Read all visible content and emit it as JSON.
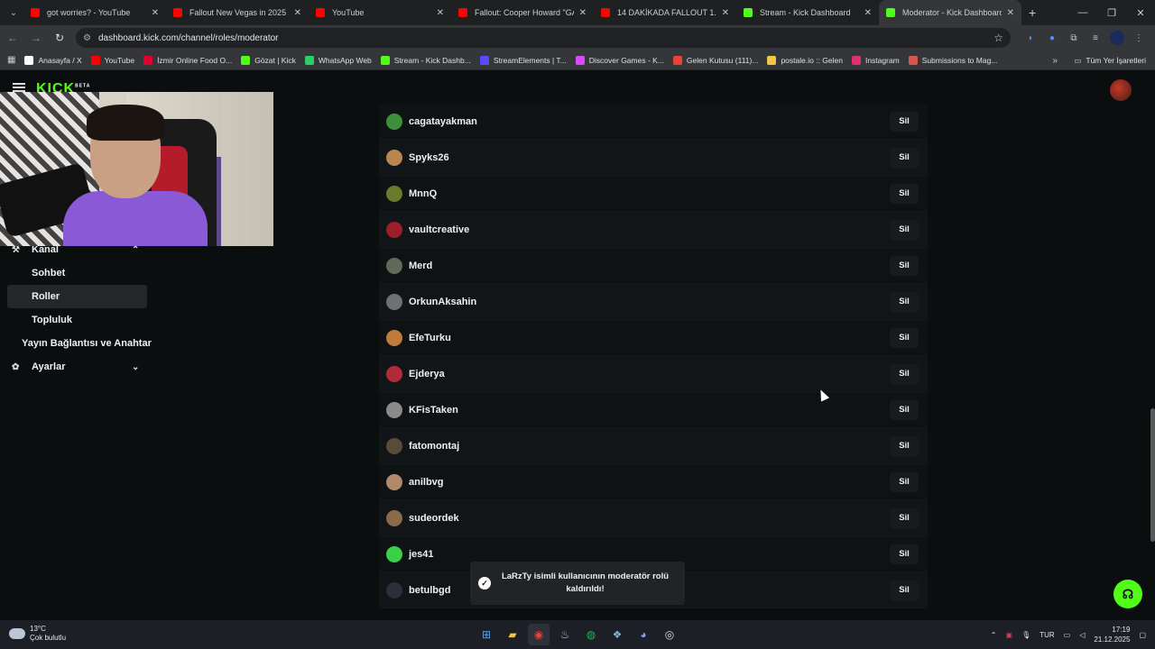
{
  "browser": {
    "tabs": [
      {
        "title": "got worries? - YouTube",
        "color": "#ff0000",
        "active": false
      },
      {
        "title": "Fallout New Vegas in 2025 is A",
        "color": "#ff0000",
        "active": false
      },
      {
        "title": "YouTube",
        "color": "#ff0000",
        "active": false
      },
      {
        "title": "Fallout: Cooper Howard \"GALA",
        "color": "#ff0000",
        "active": false
      },
      {
        "title": "14 DAKİKADA FALLOUT 1. SEZO",
        "color": "#ff0000",
        "active": false
      },
      {
        "title": "Stream - Kick Dashboard",
        "color": "#53fc18",
        "active": false
      },
      {
        "title": "Moderator - Kick Dashboard",
        "color": "#53fc18",
        "active": true
      }
    ],
    "url": "dashboard.kick.com/channel/roles/moderator",
    "bookmarks": [
      {
        "label": "Anasayfa / X",
        "color": "#ffffff"
      },
      {
        "label": "YouTube",
        "color": "#ff0000"
      },
      {
        "label": "İzmir Online Food O...",
        "color": "#e4002b"
      },
      {
        "label": "Gözat | Kick",
        "color": "#53fc18"
      },
      {
        "label": "WhatsApp Web",
        "color": "#25d366"
      },
      {
        "label": "Stream - Kick Dashb...",
        "color": "#53fc18"
      },
      {
        "label": "StreamElements | T...",
        "color": "#5b4bff"
      },
      {
        "label": "Discover Games - K...",
        "color": "#d94aff"
      },
      {
        "label": "Gelen Kutusu (111)...",
        "color": "#ea4335"
      },
      {
        "label": "postale.io :: Gelen",
        "color": "#f4c542"
      },
      {
        "label": "Instagram",
        "color": "#e1306c"
      },
      {
        "label": "Submissions to Mag...",
        "color": "#d9534f"
      }
    ],
    "all_bookmarks": "Tüm Yer İşaretleri"
  },
  "app": {
    "logo": "KICK",
    "logo_badge": "BETA"
  },
  "sidebar": {
    "items": [
      {
        "label": "Kanal",
        "type": "section",
        "icon": "channel-icon",
        "chevron": "⌃"
      },
      {
        "label": "Sohbet",
        "type": "sub"
      },
      {
        "label": "Roller",
        "type": "sub",
        "active": true
      },
      {
        "label": "Topluluk",
        "type": "sub"
      },
      {
        "label": "Yayın Bağlantısı ve Anahtar",
        "type": "plain"
      },
      {
        "label": "Ayarlar",
        "type": "section",
        "icon": "gear-icon",
        "chevron": "⌄"
      }
    ]
  },
  "moderators": {
    "remove_label": "Sil",
    "rows": [
      {
        "name": "cagatayakman",
        "avatar": "#3f8f3a"
      },
      {
        "name": "Spyks26",
        "avatar": "#b8864e"
      },
      {
        "name": "MnnQ",
        "avatar": "#6a7a2a"
      },
      {
        "name": "vaultcreative",
        "avatar": "#9a1f2a"
      },
      {
        "name": "Merd",
        "avatar": "#5e6a5a"
      },
      {
        "name": "OrkunAksahin",
        "avatar": "#707070"
      },
      {
        "name": "EfeTurku",
        "avatar": "#c07a3a"
      },
      {
        "name": "Ejderya",
        "avatar": "#b02a3a"
      },
      {
        "name": "KFisTaken",
        "avatar": "#8a8a8a"
      },
      {
        "name": "fatomontaj",
        "avatar": "#5a4a3a"
      },
      {
        "name": "anilbvg",
        "avatar": "#b08a6a"
      },
      {
        "name": "sudeordek",
        "avatar": "#8a6a4a"
      },
      {
        "name": "jes41",
        "avatar": "#3ad04a"
      },
      {
        "name": "betulbgd",
        "avatar": "#2a2f3a"
      }
    ]
  },
  "toast": {
    "message": "LaRzTy isimli kullanıcının moderatör rolü kaldırıldı!"
  },
  "taskbar": {
    "weather_temp": "13°C",
    "weather_desc": "Çok bulutlu",
    "language": "TUR",
    "time": "17:19",
    "date": "21.12.2025"
  }
}
